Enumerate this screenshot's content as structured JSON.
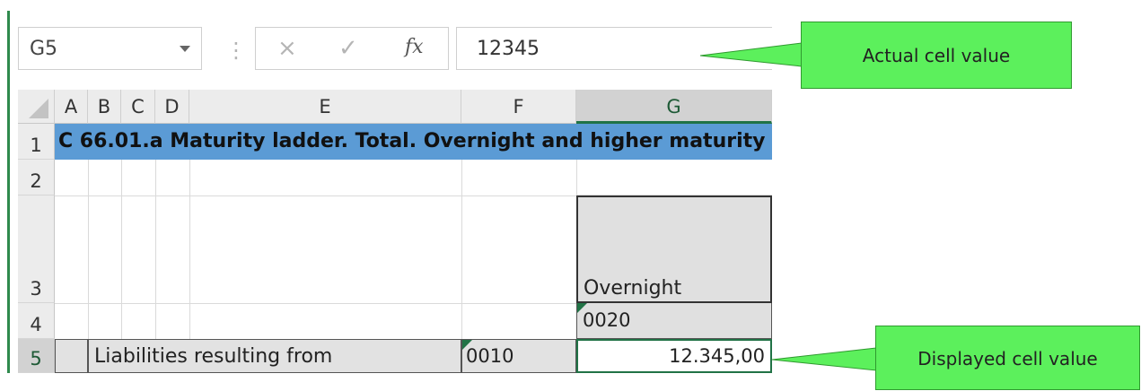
{
  "formula_bar": {
    "name_box": "G5",
    "separator": "⋮",
    "cancel_icon": "×",
    "enter_icon": "✓",
    "function_icon": "fx",
    "formula_value": "12345"
  },
  "columns": [
    "A",
    "B",
    "C",
    "D",
    "E",
    "F",
    "G"
  ],
  "selected_column": "G",
  "rows": [
    "1",
    "2",
    "3",
    "4",
    "5"
  ],
  "selected_row": "5",
  "cells": {
    "A1": "C 66.01.a Maturity ladder. Total. Overnight and higher maturity",
    "G3": "Overnight",
    "G4": "0020",
    "B5": "Liabilities resulting from",
    "F5": "0010",
    "G5": "12.345,00"
  },
  "callouts": {
    "actual": "Actual cell value",
    "displayed": "Displayed cell value"
  },
  "colors": {
    "title_band": "#5b9bd5",
    "header_fill": "#e0e0e0",
    "excel_green": "#217346",
    "callout_green": "#5cf05c"
  }
}
